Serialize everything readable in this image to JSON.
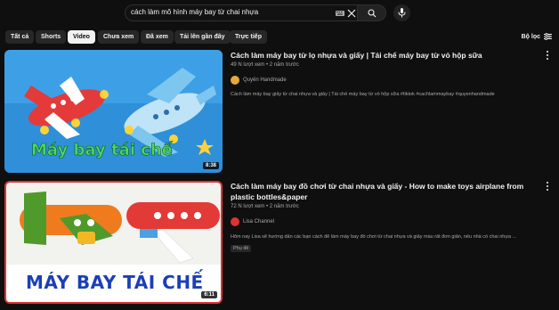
{
  "search": {
    "query": "cách làm mô hình máy bay từ chai nhựa"
  },
  "chips": [
    {
      "label": "Tất cả",
      "active": false
    },
    {
      "label": "Shorts",
      "active": false
    },
    {
      "label": "Video",
      "active": true
    },
    {
      "label": "Chưa xem",
      "active": false
    },
    {
      "label": "Đã xem",
      "active": false
    },
    {
      "label": "Tải lên gần đây",
      "active": false
    },
    {
      "label": "Trực tiếp",
      "active": false
    }
  ],
  "filter_label": "Bộ lọc",
  "results": [
    {
      "title": "Cách làm máy bay từ lọ nhựa và giấy | Tái chế máy bay từ vỏ hộp sữa",
      "meta": "49 N lượt xem • 2 năm trước",
      "channel": "Quyên Handmade",
      "description": "Cách làm máy bay giấy từ chai nhựa và giấy | Tái chế máy bay từ vỏ hộp sữa #tiktok #cachlammaybay #quyenhandmade",
      "duration": "8:38",
      "thumb_text": "Máy bay tái chế",
      "avatar_color": "#e7a93a"
    },
    {
      "title": "Cách làm máy bay đồ chơi từ chai nhựa và giấy - How to make toys airplane from plastic bottles&paper",
      "meta": "72 N lượt xem • 2 năm trước",
      "channel": "Lisa Channel",
      "description": "Hôm nay Lisa sẽ hướng dẫn các bạn cách để làm máy bay đồ chơi từ chai nhựa và giấy màu rất đơn giản, nếu nhà có chai nhựa ...",
      "badge": "Phụ đề",
      "duration": "6:11",
      "thumb_text": "MÁY BAY TÁI CHẾ",
      "avatar_color": "#d33"
    }
  ]
}
